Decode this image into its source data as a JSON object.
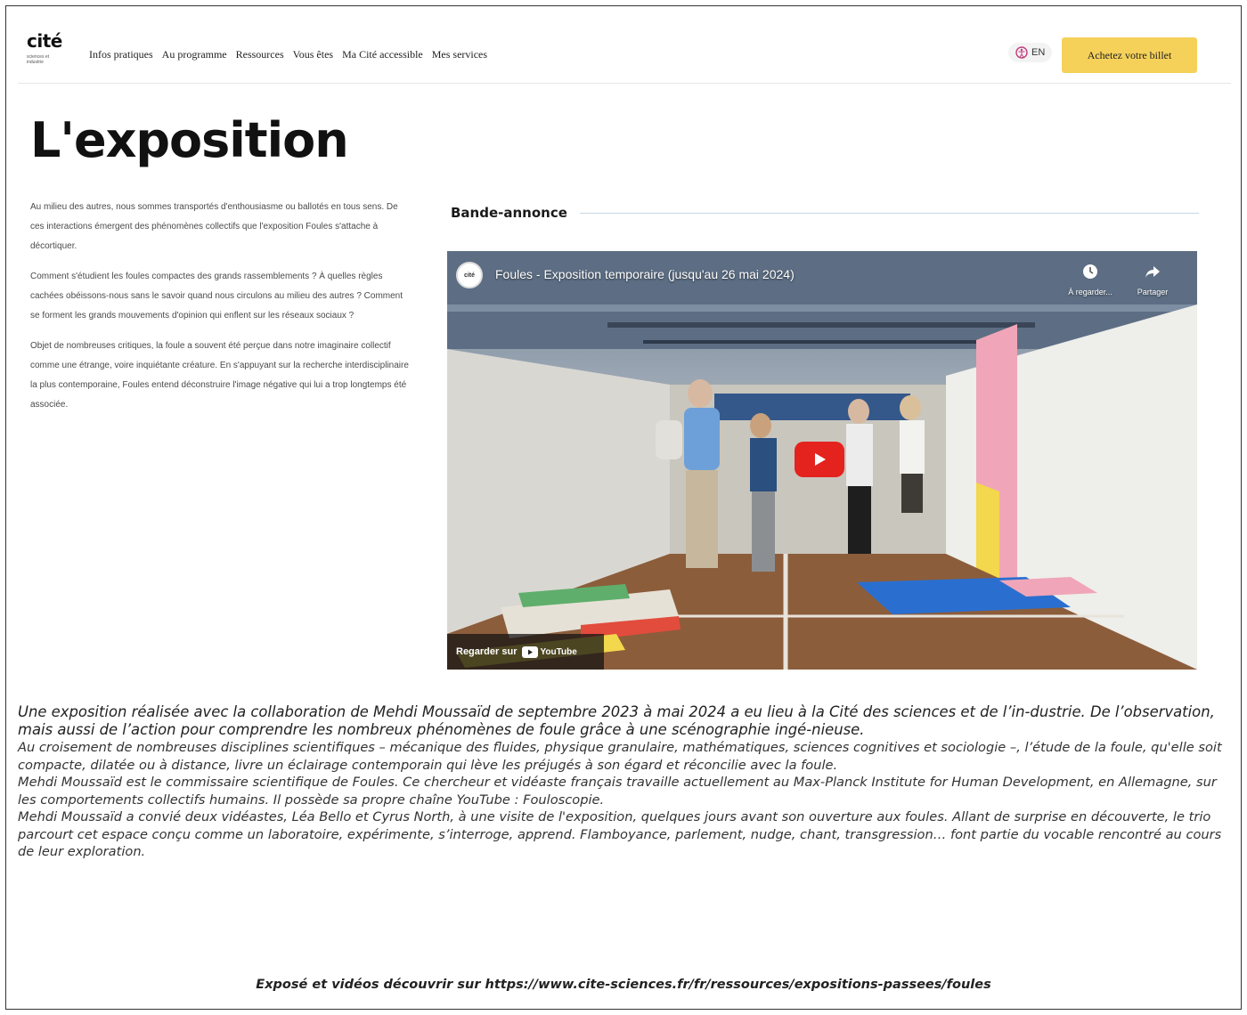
{
  "header": {
    "logo_main": "cité",
    "logo_sub": "sciences et industrie",
    "nav": [
      "Infos pratiques",
      "Au programme",
      "Ressources",
      "Vous êtes",
      "Ma Cité accessible",
      "Mes services"
    ],
    "lang": "EN",
    "buy": "Achetez votre billet"
  },
  "main": {
    "title": "L'exposition",
    "paragraphs": [
      "Au milieu des autres, nous sommes transportés d'enthousiasme ou ballotés en tous sens. De ces interactions émergent des phénomènes collectifs que l'exposition Foules s'attache à décortiquer.",
      "Comment s'étudient les foules compactes des grands rassemblements ? À quelles règles cachées obéissons-nous sans le savoir quand nous circulons au milieu des autres ? Comment se forment les grands mouvements d'opinion qui enflent sur les réseaux sociaux ?",
      "Objet de nombreuses critiques, la foule a souvent été perçue dans notre imaginaire collectif comme une étrange, voire inquiétante créature. En s'appuyant sur la recherche interdisciplinaire la plus contemporaine, Foules entend déconstruire l'image négative qui lui a trop longtemps été associée."
    ],
    "trailer_title": "Bande-annonce"
  },
  "video": {
    "channel_badge": "cité",
    "title": "Foules - Exposition temporaire (jusqu'au 26 mai 2024)",
    "watch_later": "À regarder...",
    "share": "Partager",
    "watch_on": "Regarder sur",
    "youtube": "YouTube"
  },
  "caption": {
    "lead": "Une exposition réalisée avec la collaboration de Mehdi Moussaïd de septembre 2023 à mai 2024 a eu lieu à la Cité des sciences et de l’in-dustrie. De l’observation, mais aussi de l’action pour comprendre les nombreux phénomènes de foule grâce à une scénographie ingé-nieuse.",
    "p1": "Au croisement de nombreuses disciplines scientifiques – mécanique des fluides, physique granulaire, mathématiques, sciences cognitives et sociologie –, l’étude de la foule, qu'elle soit compacte, dilatée ou à distance, livre un éclairage contemporain qui lève les préjugés à son égard et réconcilie avec la foule.",
    "p2": "Mehdi Moussaïd est le commissaire scientifique de Foules. Ce chercheur et vidéaste français travaille actuellement au Max-Planck Institute for Human Development, en Allemagne, sur les comportements collectifs humains. Il possède sa propre chaîne YouTube : Fouloscopie.",
    "p3": "Mehdi Moussaïd a convié deux vidéastes, Léa Bello et Cyrus North, à une visite de l'exposition, quelques jours avant son ouverture aux foules. Allant de surprise en découverte, le trio parcourt cet espace conçu comme un laboratoire, expérimente, s’interroge, apprend. Flamboyance, parlement, nudge, chant, transgression… font partie du vocable rencontré au cours de leur exploration.",
    "link": "Exposé et vidéos découvrir sur https://www.cite-sciences.fr/fr/ressources/expositions-passees/foules"
  },
  "colors": {
    "accent_yellow": "#f5d15a",
    "play_red": "#e4221e"
  }
}
